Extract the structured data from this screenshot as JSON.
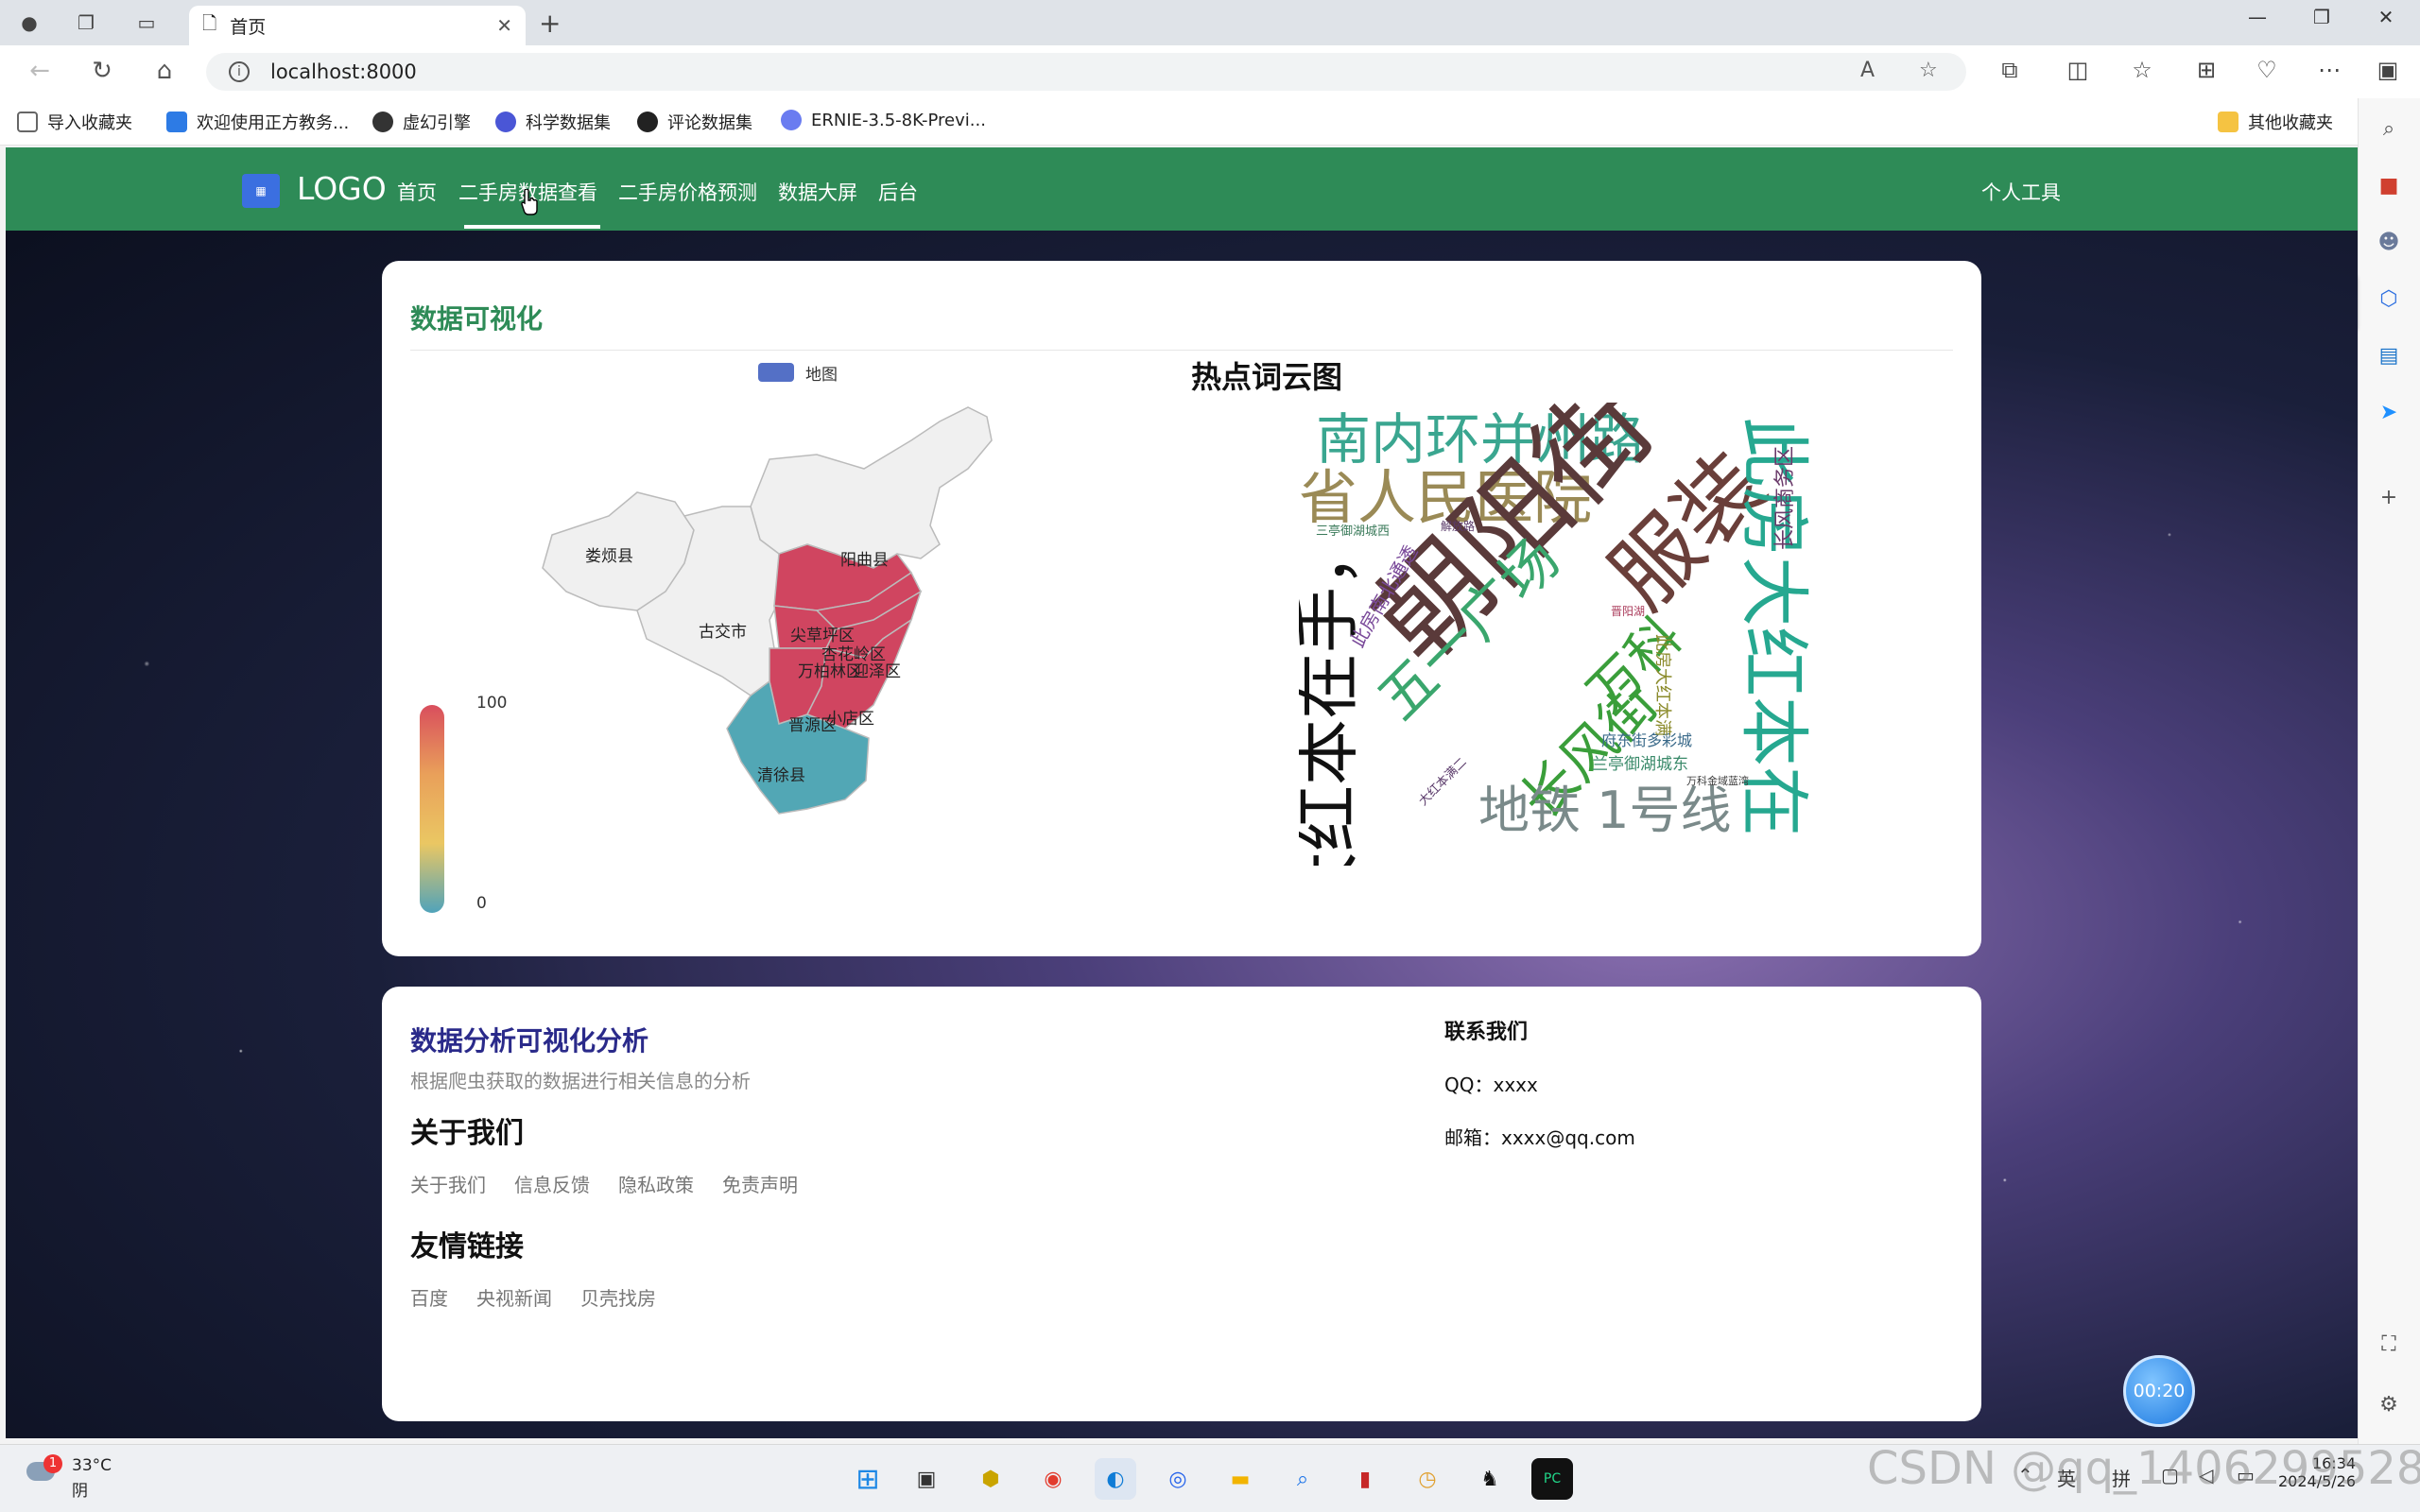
{
  "browser": {
    "tab_title": "首页",
    "url": "localhost:8000",
    "favorites": [
      {
        "label": "导入收藏夹",
        "color": "#666"
      },
      {
        "label": "欢迎使用正方教务...",
        "color": "#2d7be5"
      },
      {
        "label": "虚幻引擎",
        "color": "#333"
      },
      {
        "label": "科学数据集",
        "color": "#4a56d6"
      },
      {
        "label": "评论数据集",
        "color": "#222"
      },
      {
        "label": "ERNIE-3.5-8K-Previ...",
        "color": "#6a7cf0"
      }
    ],
    "other_favorites": "其他收藏夹"
  },
  "site": {
    "logo": "LOGO",
    "nav": [
      "首页",
      "二手房数据查看",
      "二手房价格预测",
      "数据大屏",
      "后台"
    ],
    "personal_tools": "个人工具"
  },
  "viz": {
    "section_title": "数据可视化",
    "map_legend": "地图",
    "visualmap_max": "100",
    "visualmap_min": "0",
    "regions": [
      "娄烦县",
      "阳曲县",
      "古交市",
      "尖草坪区",
      "杏花岭区",
      "万柏林区",
      "迎泽区",
      "晋源区",
      "小店区",
      "清徐县"
    ],
    "wordcloud_title": "热点词云图",
    "words": [
      "南内环并州路",
      "省人民医院",
      "朝阳街",
      "服装",
      "大红本在手，",
      "此房大红本在",
      "五一广场",
      "长风街",
      "万科",
      "地铁 1号线",
      "长风商务区",
      "此房南北通透",
      "兰亭御湖城东",
      "府东街多彩城",
      "此房大红本满",
      "三亭御湖城西",
      "大红本满二",
      "解放路",
      "晋阳湖",
      "万科金域蓝湾"
    ]
  },
  "footer": {
    "title": "数据分析可视化分析",
    "subtitle": "根据爬虫获取的数据进行相关信息的分析",
    "about_title": "关于我们",
    "about_links": [
      "关于我们",
      "信息反馈",
      "隐私政策",
      "免责声明"
    ],
    "friend_title": "友情链接",
    "friend_links": [
      "百度",
      "央视新闻",
      "贝壳找房"
    ],
    "contact_title": "联系我们",
    "qq": "QQ：xxxx",
    "email": "邮箱：xxxx@qq.com"
  },
  "timer": "00:20",
  "taskbar": {
    "temperature": "33°C",
    "weather": "阴",
    "badge": "1",
    "ime1": "英",
    "ime2": "拼",
    "time": "16:34",
    "date": "2024/5/26"
  },
  "watermark": "CSDN @qq_1406299528",
  "colors": {
    "nav_green": "#2e8b57",
    "map_high": "#d04560",
    "map_low": "#52a7b5",
    "map_none": "#f0f0f0"
  }
}
